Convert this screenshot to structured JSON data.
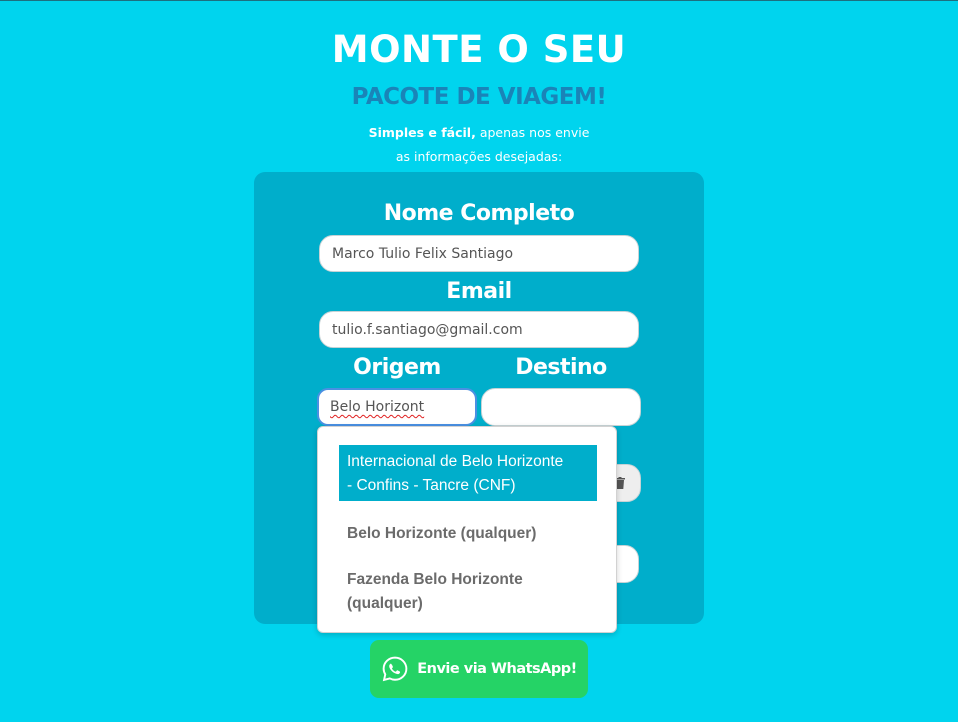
{
  "header": {
    "title": "MONTE O SEU",
    "subtitle": "PACOTE DE VIAGEM!",
    "tagline_bold": "Simples e fácil,",
    "tagline_rest": " apenas nos envie",
    "tagline_line2": "as informações desejadas:"
  },
  "form": {
    "name_label": "Nome Completo",
    "name_value": "Marco Tulio Felix Santiago",
    "email_label": "Email",
    "email_value": "tulio.f.santiago@gmail.com",
    "origin_label": "Origem",
    "origin_value": "Belo Horizont",
    "destination_label": "Destino",
    "destination_value": ""
  },
  "autocomplete": {
    "options": [
      {
        "label_line1": "Internacional de Belo Horizonte",
        "label_line2": "- Confins - Tancre (CNF)",
        "active": true
      },
      {
        "label_line1": "Belo Horizonte (qualquer)",
        "label_line2": "",
        "active": false
      },
      {
        "label_line1": "Fazenda Belo Horizonte",
        "label_line2": "(qualquer)",
        "active": false
      }
    ]
  },
  "actions": {
    "whatsapp_label": "Envie via WhatsApp!",
    "whatsapp_icon": "whatsapp-icon"
  },
  "colors": {
    "background": "#00d4ee",
    "card": "#00aecb",
    "subtitle": "#1a84b8",
    "whatsapp": "#25d366"
  }
}
